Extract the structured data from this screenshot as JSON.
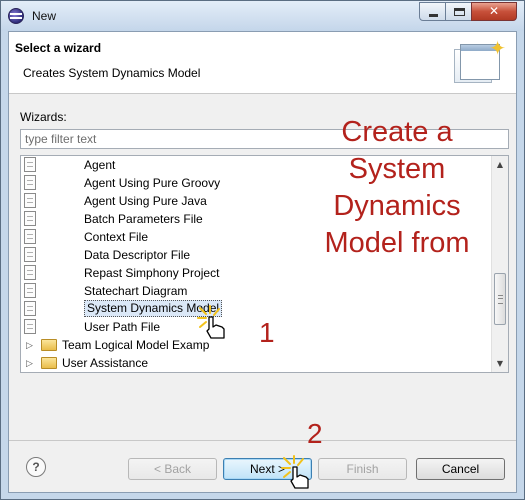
{
  "window": {
    "title": "New",
    "controls": {
      "minimize": "minimize",
      "maximize": "maximize",
      "close": "close"
    }
  },
  "banner": {
    "title": "Select a wizard",
    "subtitle": "Creates System Dynamics Model",
    "icon": "wizard-banner-icon"
  },
  "wizards": {
    "label": "Wizards:",
    "filter_placeholder": "type filter text",
    "items": [
      {
        "label": "Agent",
        "icon": "agent-icon",
        "kind": "item"
      },
      {
        "label": "Agent Using Pure Groovy",
        "icon": "agent-icon",
        "kind": "item"
      },
      {
        "label": "Agent Using Pure Java",
        "icon": "agent-icon",
        "kind": "item"
      },
      {
        "label": "Batch Parameters File",
        "icon": "file-icon",
        "kind": "item"
      },
      {
        "label": "Context File",
        "icon": "file-icon",
        "kind": "item"
      },
      {
        "label": "Data Descriptor File",
        "icon": "file-icon",
        "kind": "item"
      },
      {
        "label": "Repast Simphony Project",
        "icon": "project-icon",
        "kind": "item"
      },
      {
        "label": "Statechart Diagram",
        "icon": "diagram-icon",
        "kind": "item"
      },
      {
        "label": "System Dynamics Model",
        "icon": "diagram-icon",
        "kind": "item",
        "selected": true
      },
      {
        "label": "User Path File",
        "icon": "file-icon",
        "kind": "item"
      },
      {
        "label": "Team Logical Model Examp",
        "icon": "folder-icon",
        "kind": "folder"
      },
      {
        "label": "User Assistance",
        "icon": "folder-icon",
        "kind": "folder"
      }
    ]
  },
  "buttons": {
    "help": "?",
    "back": "< Back",
    "next": "Next >",
    "finish": "Finish",
    "cancel": "Cancel"
  },
  "annotations": {
    "callout_lines": [
      "Create a",
      "System",
      "Dynamics",
      "Model from"
    ],
    "step1": "1",
    "step2": "2",
    "color": "#b3221c"
  }
}
